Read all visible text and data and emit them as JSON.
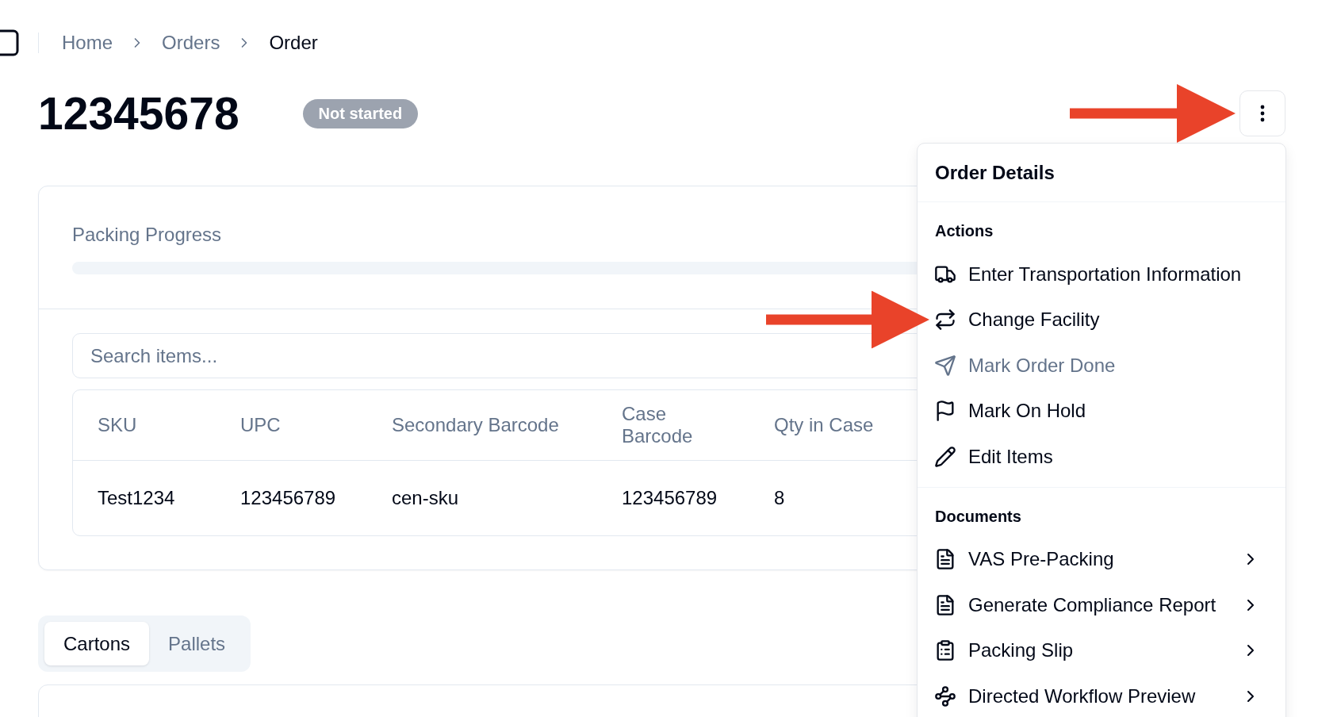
{
  "breadcrumb": [
    {
      "label": "Home",
      "current": false
    },
    {
      "label": "Orders",
      "current": false
    },
    {
      "label": "Order",
      "current": true
    }
  ],
  "header": {
    "title": "12345678",
    "status": "Not started",
    "menu_button": {
      "pointer_arrow": true
    }
  },
  "menu": {
    "title": "Order Details",
    "sections": [
      {
        "heading": "Actions",
        "items": [
          {
            "label": "Enter Transportation Information",
            "disabled": false,
            "has_submenu": false,
            "pointer_arrow": false
          },
          {
            "label": "Change Facility",
            "disabled": false,
            "has_submenu": false,
            "pointer_arrow": true
          },
          {
            "label": "Mark Order Done",
            "disabled": true,
            "has_submenu": false,
            "pointer_arrow": false
          },
          {
            "label": "Mark On Hold",
            "disabled": false,
            "has_submenu": false,
            "pointer_arrow": false
          },
          {
            "label": "Edit Items",
            "disabled": false,
            "has_submenu": false,
            "pointer_arrow": false
          }
        ]
      },
      {
        "heading": "Documents",
        "items": [
          {
            "label": "VAS Pre-Packing",
            "disabled": false,
            "has_submenu": true,
            "pointer_arrow": false
          },
          {
            "label": "Generate Compliance Report",
            "disabled": false,
            "has_submenu": true,
            "pointer_arrow": false
          },
          {
            "label": "Packing Slip",
            "disabled": false,
            "has_submenu": true,
            "pointer_arrow": false
          },
          {
            "label": "Directed Workflow Preview",
            "disabled": false,
            "has_submenu": true,
            "pointer_arrow": false
          }
        ]
      }
    ]
  },
  "packing_progress": {
    "label": "Packing Progress",
    "level": 0
  },
  "search": {
    "placeholder": "Search items..."
  },
  "table": {
    "columns": [
      "SKU",
      "UPC",
      "Secondary Barcode",
      "Case Barcode",
      "Qty in Case"
    ],
    "rows": [
      [
        "Test1234",
        "123456789",
        "cen-sku",
        "123456789",
        "8"
      ]
    ]
  },
  "tabs": [
    {
      "label": "Cartons",
      "selected": true
    },
    {
      "label": "Pallets",
      "selected": false
    }
  ]
}
